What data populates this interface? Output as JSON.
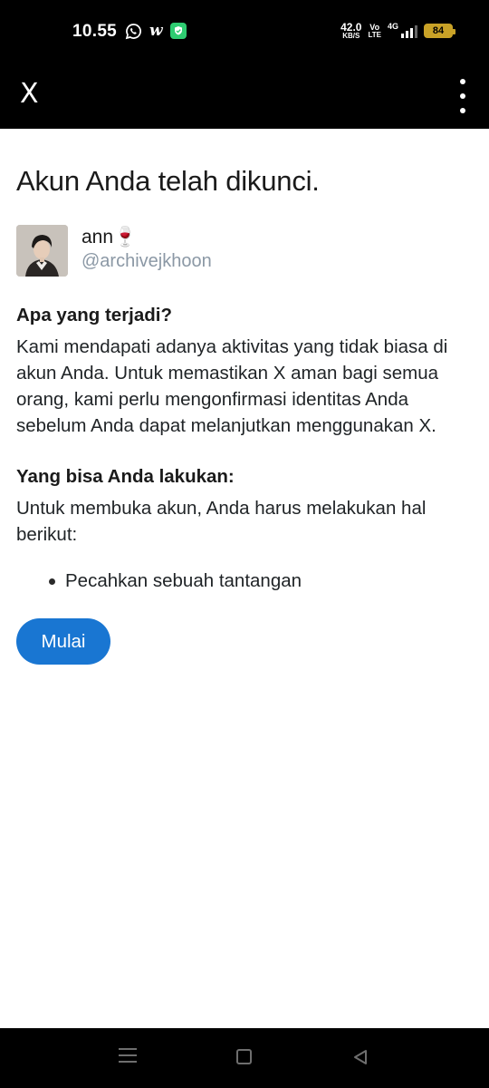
{
  "status_bar": {
    "time": "10.55",
    "net_speed_value": "42.0",
    "net_speed_unit": "KB/S",
    "volte_top": "Vo",
    "volte_bottom": "LTE",
    "network": "4G",
    "battery": "84",
    "icons": [
      "whatsapp-icon",
      "w-app-icon",
      "shield-vpn-icon",
      "signal-icon",
      "battery-icon"
    ]
  },
  "app_bar": {
    "title": "X",
    "menu_icon": "more-vertical-icon"
  },
  "main": {
    "title": "Akun Anda telah dikunci.",
    "profile": {
      "name": "ann🍷",
      "handle": "@archivejkhoon"
    },
    "section1": {
      "heading": "Apa yang terjadi?",
      "body": "Kami mendapati adanya aktivitas yang tidak biasa di akun Anda. Untuk memastikan X aman bagi semua orang, kami perlu mengonfirmasi identitas Anda sebelum Anda dapat melanjutkan menggunakan X."
    },
    "section2": {
      "heading": "Yang bisa Anda lakukan:",
      "body": "Untuk membuka akun, Anda harus melakukan hal berikut:",
      "steps": [
        "Pecahkan sebuah tantangan"
      ]
    },
    "start_button": "Mulai"
  },
  "nav_bar": {
    "icons": [
      "recent-apps-icon",
      "home-icon",
      "back-icon"
    ]
  },
  "colors": {
    "bar_background": "#000000",
    "primary_button": "#1976d2",
    "handle_text": "#8b98a5",
    "battery": "#c9a227"
  }
}
